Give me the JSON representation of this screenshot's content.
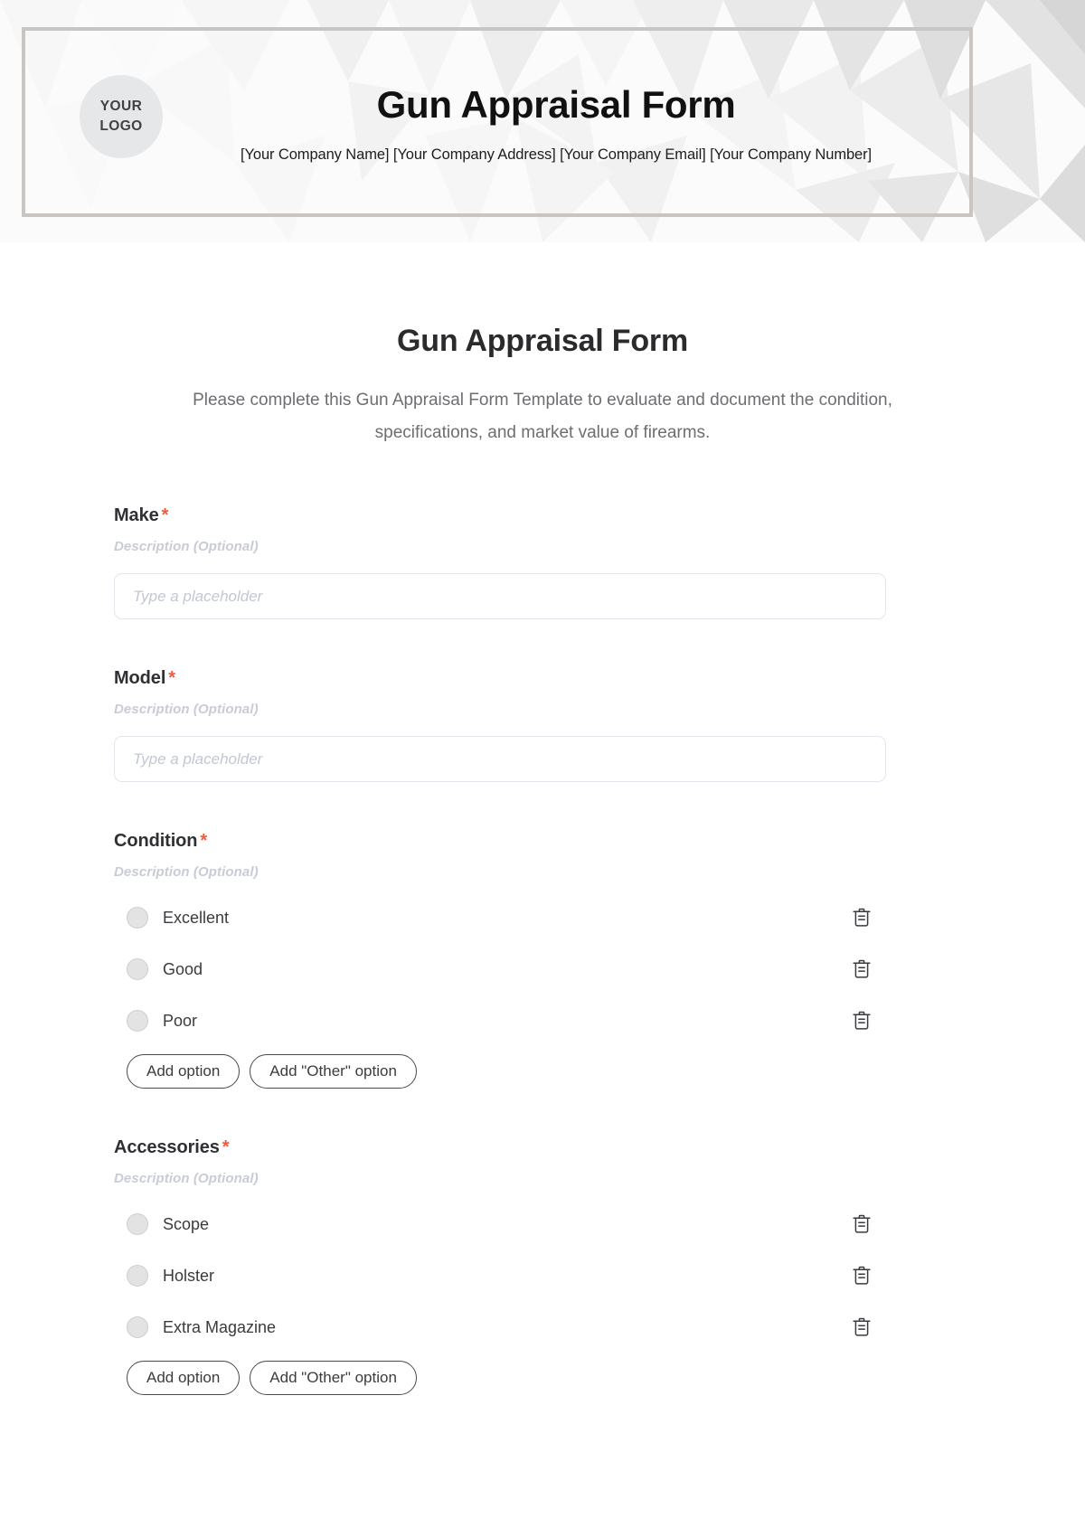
{
  "header": {
    "logo_line1": "YOUR",
    "logo_line2": "LOGO",
    "banner_title": "Gun Appraisal Form",
    "contact_line": "[Your Company Name] [Your Company Address] [Your Company Email] [Your Company Number]"
  },
  "form": {
    "title": "Gun Appraisal Form",
    "subtitle": "Please complete this Gun Appraisal Form Template to evaluate and document the condition, specifications, and market value of firearms.",
    "description_placeholder": "Description (Optional)",
    "input_placeholder": "Type a placeholder",
    "required_marker": "*",
    "add_option_label": "Add option",
    "add_other_option_label": "Add \"Other\" option",
    "fields": [
      {
        "label": "Make",
        "required": true,
        "type": "text",
        "description": "Description (Optional)",
        "placeholder": "Type a placeholder",
        "value": ""
      },
      {
        "label": "Model",
        "required": true,
        "type": "text",
        "description": "Description (Optional)",
        "placeholder": "Type a placeholder",
        "value": ""
      },
      {
        "label": "Condition",
        "required": true,
        "type": "radio",
        "description": "Description (Optional)",
        "options": [
          "Excellent",
          "Good",
          "Poor"
        ]
      },
      {
        "label": "Accessories",
        "required": true,
        "type": "radio",
        "description": "Description (Optional)",
        "options": [
          "Scope",
          "Holster",
          "Extra Magazine"
        ]
      }
    ]
  },
  "colors": {
    "required_star": "#f4593b",
    "title": "#2b2b2e",
    "subtitle": "#6d6e72",
    "description": "#c9ccd6",
    "input_border": "#e2e5ec",
    "frame_border": "#c9c5c2",
    "logo_bg": "#e6e7e9",
    "radio_fill": "#e3e3e3",
    "add_button_border": "#4a4a4a"
  },
  "icons": {
    "delete": "trash-icon"
  }
}
